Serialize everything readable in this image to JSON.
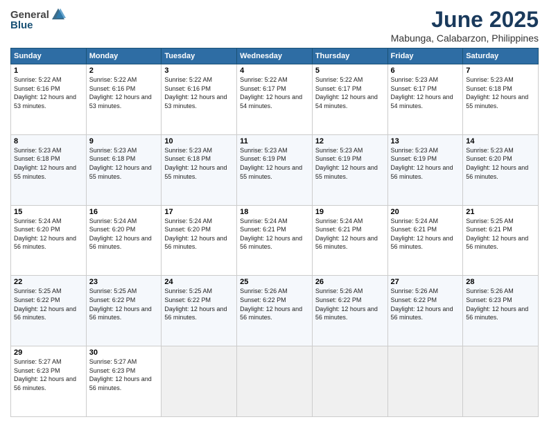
{
  "header": {
    "logo": {
      "general": "General",
      "blue": "Blue"
    },
    "title": "June 2025",
    "subtitle": "Mabunga, Calabarzon, Philippines"
  },
  "calendar": {
    "days_of_week": [
      "Sunday",
      "Monday",
      "Tuesday",
      "Wednesday",
      "Thursday",
      "Friday",
      "Saturday"
    ],
    "weeks": [
      [
        null,
        null,
        null,
        null,
        null,
        null,
        null
      ]
    ]
  },
  "cells": {
    "w1": [
      {
        "num": "1",
        "sunrise": "Sunrise: 5:22 AM",
        "sunset": "Sunset: 6:16 PM",
        "daylight": "Daylight: 12 hours and 53 minutes."
      },
      {
        "num": "2",
        "sunrise": "Sunrise: 5:22 AM",
        "sunset": "Sunset: 6:16 PM",
        "daylight": "Daylight: 12 hours and 53 minutes."
      },
      {
        "num": "3",
        "sunrise": "Sunrise: 5:22 AM",
        "sunset": "Sunset: 6:16 PM",
        "daylight": "Daylight: 12 hours and 53 minutes."
      },
      {
        "num": "4",
        "sunrise": "Sunrise: 5:22 AM",
        "sunset": "Sunset: 6:17 PM",
        "daylight": "Daylight: 12 hours and 54 minutes."
      },
      {
        "num": "5",
        "sunrise": "Sunrise: 5:22 AM",
        "sunset": "Sunset: 6:17 PM",
        "daylight": "Daylight: 12 hours and 54 minutes."
      },
      {
        "num": "6",
        "sunrise": "Sunrise: 5:23 AM",
        "sunset": "Sunset: 6:17 PM",
        "daylight": "Daylight: 12 hours and 54 minutes."
      },
      {
        "num": "7",
        "sunrise": "Sunrise: 5:23 AM",
        "sunset": "Sunset: 6:18 PM",
        "daylight": "Daylight: 12 hours and 55 minutes."
      }
    ],
    "w2": [
      {
        "num": "8",
        "sunrise": "Sunrise: 5:23 AM",
        "sunset": "Sunset: 6:18 PM",
        "daylight": "Daylight: 12 hours and 55 minutes."
      },
      {
        "num": "9",
        "sunrise": "Sunrise: 5:23 AM",
        "sunset": "Sunset: 6:18 PM",
        "daylight": "Daylight: 12 hours and 55 minutes."
      },
      {
        "num": "10",
        "sunrise": "Sunrise: 5:23 AM",
        "sunset": "Sunset: 6:18 PM",
        "daylight": "Daylight: 12 hours and 55 minutes."
      },
      {
        "num": "11",
        "sunrise": "Sunrise: 5:23 AM",
        "sunset": "Sunset: 6:19 PM",
        "daylight": "Daylight: 12 hours and 55 minutes."
      },
      {
        "num": "12",
        "sunrise": "Sunrise: 5:23 AM",
        "sunset": "Sunset: 6:19 PM",
        "daylight": "Daylight: 12 hours and 55 minutes."
      },
      {
        "num": "13",
        "sunrise": "Sunrise: 5:23 AM",
        "sunset": "Sunset: 6:19 PM",
        "daylight": "Daylight: 12 hours and 56 minutes."
      },
      {
        "num": "14",
        "sunrise": "Sunrise: 5:23 AM",
        "sunset": "Sunset: 6:20 PM",
        "daylight": "Daylight: 12 hours and 56 minutes."
      }
    ],
    "w3": [
      {
        "num": "15",
        "sunrise": "Sunrise: 5:24 AM",
        "sunset": "Sunset: 6:20 PM",
        "daylight": "Daylight: 12 hours and 56 minutes."
      },
      {
        "num": "16",
        "sunrise": "Sunrise: 5:24 AM",
        "sunset": "Sunset: 6:20 PM",
        "daylight": "Daylight: 12 hours and 56 minutes."
      },
      {
        "num": "17",
        "sunrise": "Sunrise: 5:24 AM",
        "sunset": "Sunset: 6:20 PM",
        "daylight": "Daylight: 12 hours and 56 minutes."
      },
      {
        "num": "18",
        "sunrise": "Sunrise: 5:24 AM",
        "sunset": "Sunset: 6:21 PM",
        "daylight": "Daylight: 12 hours and 56 minutes."
      },
      {
        "num": "19",
        "sunrise": "Sunrise: 5:24 AM",
        "sunset": "Sunset: 6:21 PM",
        "daylight": "Daylight: 12 hours and 56 minutes."
      },
      {
        "num": "20",
        "sunrise": "Sunrise: 5:24 AM",
        "sunset": "Sunset: 6:21 PM",
        "daylight": "Daylight: 12 hours and 56 minutes."
      },
      {
        "num": "21",
        "sunrise": "Sunrise: 5:25 AM",
        "sunset": "Sunset: 6:21 PM",
        "daylight": "Daylight: 12 hours and 56 minutes."
      }
    ],
    "w4": [
      {
        "num": "22",
        "sunrise": "Sunrise: 5:25 AM",
        "sunset": "Sunset: 6:22 PM",
        "daylight": "Daylight: 12 hours and 56 minutes."
      },
      {
        "num": "23",
        "sunrise": "Sunrise: 5:25 AM",
        "sunset": "Sunset: 6:22 PM",
        "daylight": "Daylight: 12 hours and 56 minutes."
      },
      {
        "num": "24",
        "sunrise": "Sunrise: 5:25 AM",
        "sunset": "Sunset: 6:22 PM",
        "daylight": "Daylight: 12 hours and 56 minutes."
      },
      {
        "num": "25",
        "sunrise": "Sunrise: 5:26 AM",
        "sunset": "Sunset: 6:22 PM",
        "daylight": "Daylight: 12 hours and 56 minutes."
      },
      {
        "num": "26",
        "sunrise": "Sunrise: 5:26 AM",
        "sunset": "Sunset: 6:22 PM",
        "daylight": "Daylight: 12 hours and 56 minutes."
      },
      {
        "num": "27",
        "sunrise": "Sunrise: 5:26 AM",
        "sunset": "Sunset: 6:22 PM",
        "daylight": "Daylight: 12 hours and 56 minutes."
      },
      {
        "num": "28",
        "sunrise": "Sunrise: 5:26 AM",
        "sunset": "Sunset: 6:23 PM",
        "daylight": "Daylight: 12 hours and 56 minutes."
      }
    ],
    "w5": [
      {
        "num": "29",
        "sunrise": "Sunrise: 5:27 AM",
        "sunset": "Sunset: 6:23 PM",
        "daylight": "Daylight: 12 hours and 56 minutes."
      },
      {
        "num": "30",
        "sunrise": "Sunrise: 5:27 AM",
        "sunset": "Sunset: 6:23 PM",
        "daylight": "Daylight: 12 hours and 56 minutes."
      },
      null,
      null,
      null,
      null,
      null
    ]
  },
  "dow": [
    "Sunday",
    "Monday",
    "Tuesday",
    "Wednesday",
    "Thursday",
    "Friday",
    "Saturday"
  ]
}
